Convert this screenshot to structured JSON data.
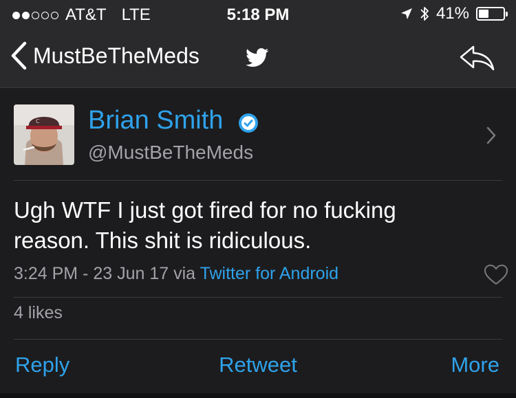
{
  "status_bar": {
    "carrier": "AT&T",
    "network": "LTE",
    "time": "5:18 PM",
    "battery_percent": "41%",
    "battery_level": 0.41,
    "signal_bars_filled": 2,
    "signal_bars_total": 5
  },
  "nav": {
    "back_label": "MustBeTheMeds"
  },
  "tweet": {
    "author_name": "Brian Smith",
    "author_handle": "@MustBeTheMeds",
    "text": "Ugh WTF I just got fired for no fucking reason. This shit is ridiculous.",
    "time_date": "3:24 PM - 23 Jun 17",
    "via_label": "via",
    "source": "Twitter for Android",
    "likes": "4 likes"
  },
  "actions": {
    "reply": "Reply",
    "retweet": "Retweet",
    "more": "More"
  },
  "colors": {
    "accent": "#2fa2eb",
    "background": "#1c1c1e",
    "header": "#2a2a2c",
    "secondary_text": "#a2a2a8"
  },
  "icons": [
    "back-chevron-icon",
    "twitter-bird-icon",
    "share-icon",
    "verified-badge-icon",
    "chevron-right-icon",
    "heart-icon",
    "location-icon",
    "bluetooth-icon",
    "battery-icon"
  ]
}
